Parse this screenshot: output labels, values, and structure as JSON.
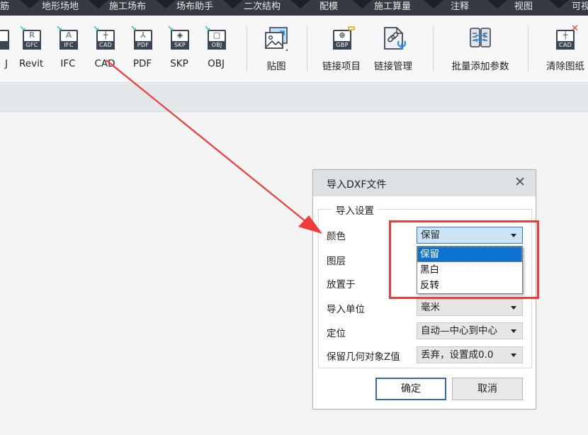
{
  "tabs": [
    "筋",
    "地形场地",
    "施工场布",
    "场布助手",
    "二次结构",
    "配模",
    "施工算量",
    "注释",
    "视图",
    "可视"
  ],
  "ribbon": {
    "import_buttons": [
      {
        "label": "J",
        "band": "",
        "icon": "partial-import-icon"
      },
      {
        "label": "Revit",
        "band": "GFC",
        "glyph": "R",
        "icon": "revit-gfc-import-icon"
      },
      {
        "label": "IFC",
        "band": "IFC",
        "glyph": "A",
        "icon": "ifc-import-icon"
      },
      {
        "label": "CAD",
        "band": "CAD",
        "glyph": "┼",
        "icon": "cad-import-icon"
      },
      {
        "label": "PDF",
        "band": "PDF",
        "glyph": "⅄",
        "icon": "pdf-import-icon"
      },
      {
        "label": "SKP",
        "band": "SKP",
        "glyph": "◈",
        "icon": "skp-import-icon"
      },
      {
        "label": "OBJ",
        "band": "OBJ",
        "glyph": "▢",
        "icon": "obj-import-icon"
      }
    ],
    "texture_label": "贴图",
    "link_project_label": "链接项目",
    "link_project_band": "GBP",
    "link_manage_label": "链接管理",
    "batch_params_label": "批量添加参数",
    "clear_drawing_label": "清除图纸",
    "clear_drawing_band": "CAD"
  },
  "dialog": {
    "title": "导入DXF文件",
    "close": "✕",
    "group_title": "导入设置",
    "rows": [
      {
        "label": "颜色",
        "value": "保留"
      },
      {
        "label": "图层",
        "value": ""
      },
      {
        "label": "放置于",
        "value": ""
      },
      {
        "label": "导入单位",
        "value": "毫米"
      },
      {
        "label": "定位",
        "value": "自动—中心到中心"
      },
      {
        "label": "保留几何对象Z值",
        "value": "丢弃，设置成0.0"
      }
    ],
    "color_options": [
      "保留",
      "黑白",
      "反转"
    ],
    "color_selected": "保留",
    "ok_label": "确定",
    "cancel_label": "取消"
  },
  "annotation": {
    "color": "#f23a3a"
  }
}
